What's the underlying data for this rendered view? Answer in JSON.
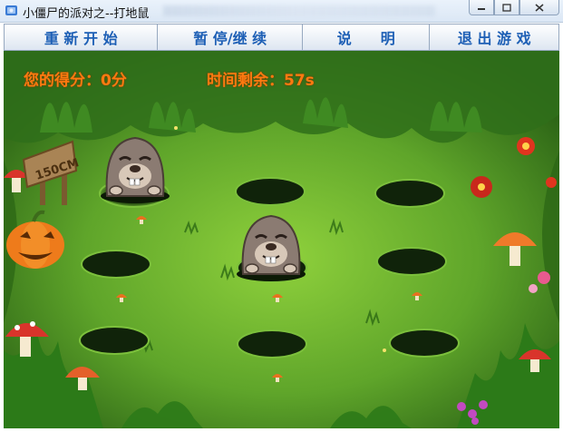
{
  "window": {
    "title": "小僵尸的派对之--打地鼠",
    "controls": [
      "minimize-icon",
      "maximize-icon",
      "close-icon"
    ]
  },
  "toolbar": {
    "restart": "重 新 开 始",
    "pause": "暂 停/继 续",
    "help": "说　　明",
    "exit": "退 出 游 戏"
  },
  "hud": {
    "score": "您的得分：0分",
    "time": "时间剩余：57s"
  },
  "board": {
    "sign_text": "150CM",
    "holes": 10,
    "moles_visible": 2,
    "colors": {
      "grass": "#5fa52a",
      "hud_text": "#ff7a10",
      "button_text": "#1d5fb5"
    }
  }
}
